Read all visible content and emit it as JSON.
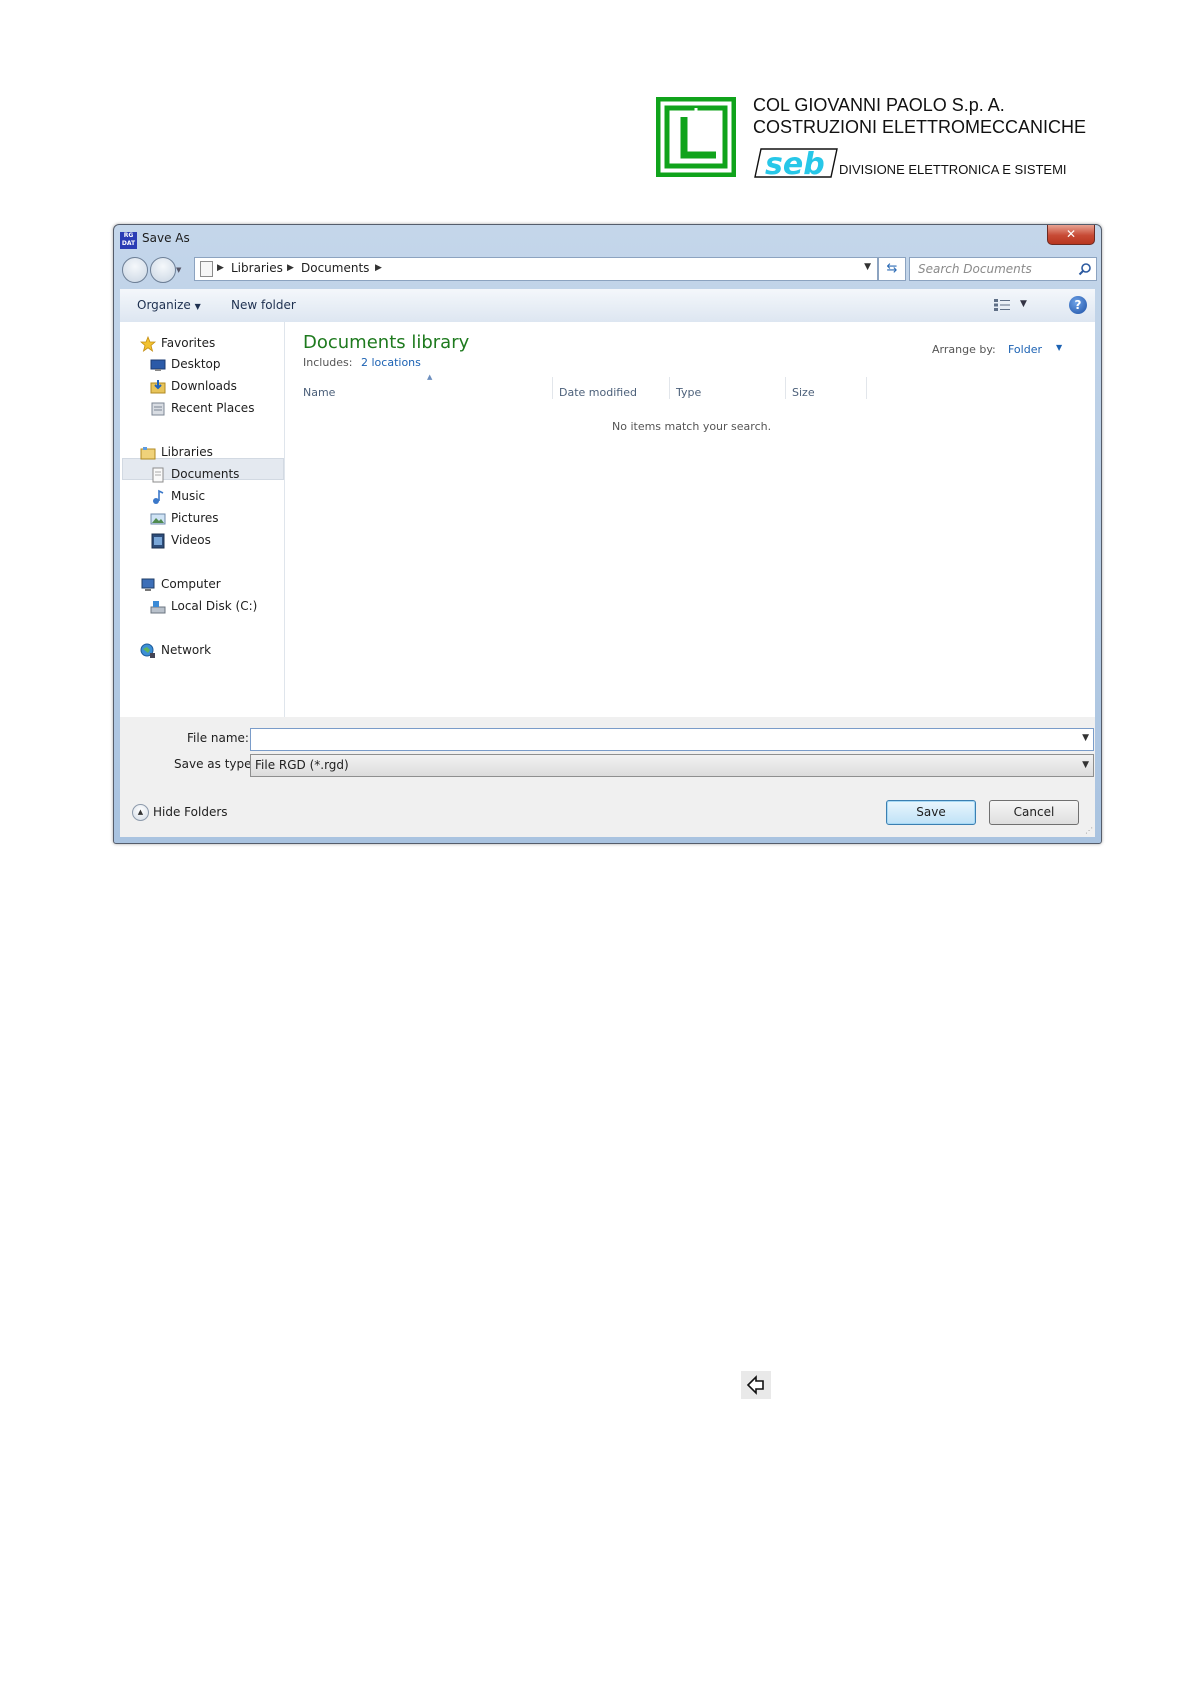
{
  "letterhead": {
    "company_line1": "COL GIOVANNI PAOLO  S.p. A.",
    "company_line2": "COSTRUZIONI ELETTROMECCANICHE",
    "seb_mark": "seb",
    "division": "DIVISIONE ELETTRONICA E SISTEMI",
    "logo_color": "#10a31b",
    "seb_color": "#27c7e8"
  },
  "dialog": {
    "app_icon_text": "RG DAT",
    "title": "Save As",
    "close_label": "x",
    "breadcrumb": [
      "Libraries",
      "Documents"
    ],
    "search_placeholder": "Search Documents",
    "toolbar": {
      "organize": "Organize",
      "new_folder": "New folder"
    },
    "nav": {
      "favorites": "Favorites",
      "desktop": "Desktop",
      "downloads": "Downloads",
      "recent_places": "Recent Places",
      "libraries": "Libraries",
      "documents": "Documents",
      "music": "Music",
      "pictures": "Pictures",
      "videos": "Videos",
      "computer": "Computer",
      "local_disk": "Local Disk (C:)",
      "network": "Network"
    },
    "library": {
      "title": "Documents library",
      "includes_label": "Includes:",
      "locations_link": "2 locations",
      "arrange_label": "Arrange by:",
      "arrange_value": "Folder"
    },
    "columns": [
      "Name",
      "Date modified",
      "Type",
      "Size"
    ],
    "empty_message": "No items match your search.",
    "file_name_label": "File name:",
    "file_name_value": "",
    "save_as_type_label": "Save as type:",
    "save_as_type_value": "File RGD (*.rgd)",
    "hide_folders": "Hide Folders",
    "save_button": "Save",
    "cancel_button": "Cancel"
  }
}
